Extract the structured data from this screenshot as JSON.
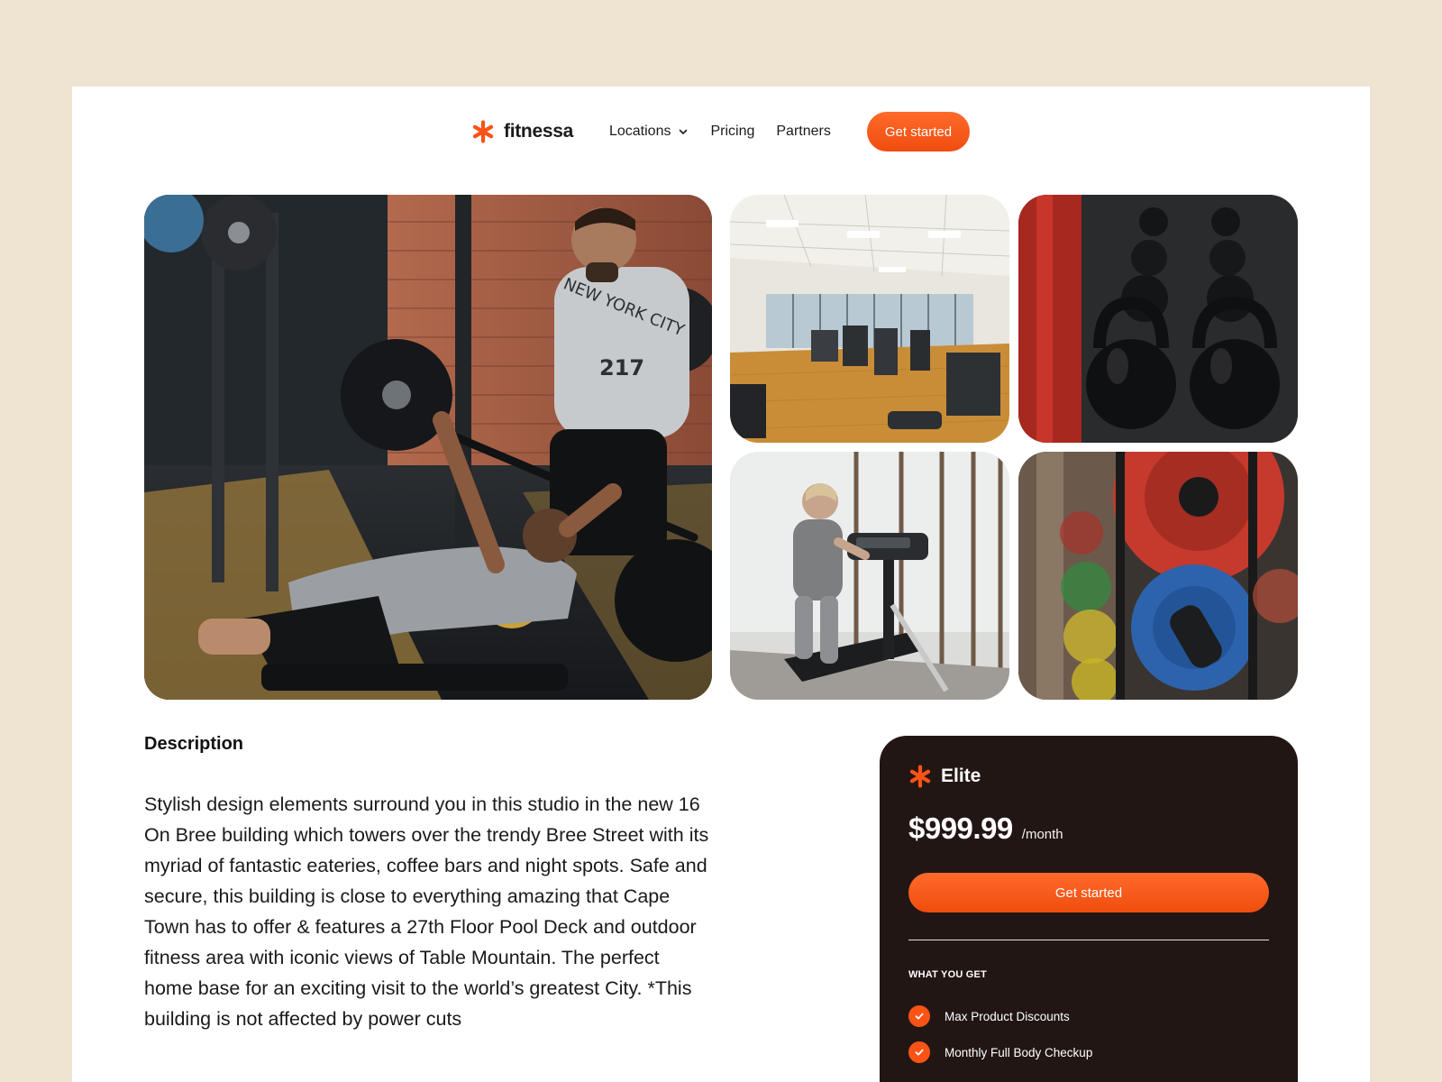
{
  "brand": {
    "name": "fitnessa",
    "accent_color": "#fb5316"
  },
  "nav": {
    "items": [
      {
        "label": "Locations",
        "has_dropdown": true
      },
      {
        "label": "Pricing"
      },
      {
        "label": "Partners"
      }
    ],
    "cta_label": "Get started"
  },
  "gallery": {
    "images": [
      {
        "icon": "photo-bench-press"
      },
      {
        "icon": "photo-gym-interior"
      },
      {
        "icon": "photo-kettlebells"
      },
      {
        "icon": "photo-treadmill"
      },
      {
        "icon": "photo-weight-plates"
      }
    ]
  },
  "description": {
    "title": "Description",
    "body": "Stylish design elements surround you in this  studio in the  new 16 On Bree building which towers over the trendy Bree Street with its myriad of fantastic eateries, coffee bars and night spots. Safe and secure, this building is close to everything amazing that Cape Town has to offer & features a 27th Floor Pool Deck and outdoor fitness area with iconic views of Table Mountain. The perfect home base for an exciting visit to the world’s greatest City. *This building is not affected by power cuts"
  },
  "plan": {
    "name": "Elite",
    "price": "$999.99",
    "period": "/month",
    "cta_label": "Get started",
    "features_heading": "WHAT YOU GET",
    "features": [
      "Max Product Discounts",
      "Monthly Full Body Checkup"
    ],
    "card_color": "#221615"
  }
}
